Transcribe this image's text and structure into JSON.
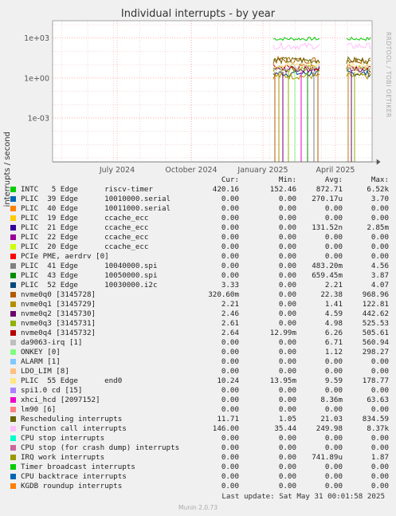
{
  "title": "Individual interrupts - by year",
  "side_label": "RRDTOOL / TOBI OETIKER",
  "footer": {
    "last_update": "Last update: Sat May 31 00:01:58 2025",
    "version": "Munin 2.0.73"
  },
  "legend_headers": {
    "cur": "Cur:",
    "min": "Min:",
    "avg": "Avg:",
    "max": "Max:"
  },
  "chart_data": {
    "type": "line",
    "title": "Individual interrupts - by year",
    "ylabel": "interrupts / second",
    "y_scale": "log",
    "y_ticks": [
      "1e+03",
      "1e+00",
      "1e-03"
    ],
    "y_tick_values": [
      1000,
      1,
      0.001
    ],
    "ylim": [
      5e-07,
      20000
    ],
    "x_ticks": [
      "July 2024",
      "October 2024",
      "January 2025",
      "April 2025"
    ],
    "grid": true,
    "series": [
      {
        "name": "INTC   5 Edge      riscv-timer",
        "color": "#00cc00",
        "cur": "420.16",
        "min": "152.46",
        "avg": "872.71",
        "max": "6.52k"
      },
      {
        "name": "PLIC  39 Edge      10010000.serial",
        "color": "#0066b3",
        "cur": "0.00",
        "min": "0.00",
        "avg": "270.17u",
        "max": "3.70"
      },
      {
        "name": "PLIC  40 Edge      10011000.serial",
        "color": "#ff8000",
        "cur": "0.00",
        "min": "0.00",
        "avg": "0.00",
        "max": "0.00"
      },
      {
        "name": "PLIC  19 Edge      ccache_ecc",
        "color": "#ffcc00",
        "cur": "0.00",
        "min": "0.00",
        "avg": "0.00",
        "max": "0.00"
      },
      {
        "name": "PLIC  21 Edge      ccache_ecc",
        "color": "#330099",
        "cur": "0.00",
        "min": "0.00",
        "avg": "131.52n",
        "max": "2.85m"
      },
      {
        "name": "PLIC  22 Edge      ccache_ecc",
        "color": "#990099",
        "cur": "0.00",
        "min": "0.00",
        "avg": "0.00",
        "max": "0.00"
      },
      {
        "name": "PLIC  20 Edge      ccache_ecc",
        "color": "#ccff00",
        "cur": "0.00",
        "min": "0.00",
        "avg": "0.00",
        "max": "0.00"
      },
      {
        "name": "PCIe PME, aerdrv [0]",
        "color": "#ff0000",
        "cur": "0.00",
        "min": "0.00",
        "avg": "0.00",
        "max": "0.00"
      },
      {
        "name": "PLIC  41 Edge      10040000.spi",
        "color": "#808080",
        "cur": "0.00",
        "min": "0.00",
        "avg": "483.20m",
        "max": "4.56"
      },
      {
        "name": "PLIC  43 Edge      10050000.spi",
        "color": "#008f00",
        "cur": "0.00",
        "min": "0.00",
        "avg": "659.45m",
        "max": "3.87"
      },
      {
        "name": "PLIC  52 Edge      10030000.i2c",
        "color": "#00487d",
        "cur": "3.33",
        "min": "0.00",
        "avg": "2.21",
        "max": "4.07"
      },
      {
        "name": "nvme0q0 [3145728]",
        "color": "#b35a00",
        "cur": "320.60m",
        "min": "0.00",
        "avg": "22.38",
        "max": "968.96"
      },
      {
        "name": "nvme0q1 [3145729]",
        "color": "#b38f00",
        "cur": "2.21",
        "min": "0.00",
        "avg": "1.41",
        "max": "122.81"
      },
      {
        "name": "nvme0q2 [3145730]",
        "color": "#6b006b",
        "cur": "2.46",
        "min": "0.00",
        "avg": "4.59",
        "max": "442.62"
      },
      {
        "name": "nvme0q3 [3145731]",
        "color": "#8fb300",
        "cur": "2.61",
        "min": "0.00",
        "avg": "4.98",
        "max": "525.53"
      },
      {
        "name": "nvme0q4 [3145732]",
        "color": "#b30000",
        "cur": "2.64",
        "min": "12.99m",
        "avg": "6.26",
        "max": "505.61"
      },
      {
        "name": "da9063-irq [1]",
        "color": "#bebebe",
        "cur": "0.00",
        "min": "0.00",
        "avg": "6.71",
        "max": "560.94"
      },
      {
        "name": "ONKEY [0]",
        "color": "#80ff80",
        "cur": "0.00",
        "min": "0.00",
        "avg": "1.12",
        "max": "298.27"
      },
      {
        "name": "ALARM [1]",
        "color": "#80c9ff",
        "cur": "0.00",
        "min": "0.00",
        "avg": "0.00",
        "max": "0.00"
      },
      {
        "name": "LDO_LIM [8]",
        "color": "#ffc080",
        "cur": "0.00",
        "min": "0.00",
        "avg": "0.00",
        "max": "0.00"
      },
      {
        "name": "PLIC  55 Edge      end0",
        "color": "#ffe680",
        "cur": "10.24",
        "min": "13.95m",
        "avg": "9.59",
        "max": "178.77"
      },
      {
        "name": "spi1.0 cd [15]",
        "color": "#aa80ff",
        "cur": "0.00",
        "min": "0.00",
        "avg": "0.00",
        "max": "0.00"
      },
      {
        "name": "xhci_hcd [2097152]",
        "color": "#ee00cc",
        "cur": "0.00",
        "min": "0.00",
        "avg": "8.36m",
        "max": "63.63"
      },
      {
        "name": "lm90 [6]",
        "color": "#ff8080",
        "cur": "0.00",
        "min": "0.00",
        "avg": "0.00",
        "max": "0.00"
      },
      {
        "name": "Rescheduling interrupts",
        "color": "#666600",
        "cur": "11.71",
        "min": "1.05",
        "avg": "21.03",
        "max": "834.59"
      },
      {
        "name": "Function call interrupts",
        "color": "#ffbfff",
        "cur": "146.00",
        "min": "35.44",
        "avg": "249.98",
        "max": "8.37k"
      },
      {
        "name": "CPU stop interrupts",
        "color": "#00ffcc",
        "cur": "0.00",
        "min": "0.00",
        "avg": "0.00",
        "max": "0.00"
      },
      {
        "name": "CPU stop (for crash dump) interrupts",
        "color": "#cc6699",
        "cur": "0.00",
        "min": "0.00",
        "avg": "0.00",
        "max": "0.00"
      },
      {
        "name": "IRQ work interrupts",
        "color": "#999900",
        "cur": "0.00",
        "min": "0.00",
        "avg": "741.89u",
        "max": "1.87"
      },
      {
        "name": "Timer broadcast interrupts",
        "color": "#00cc00",
        "cur": "0.00",
        "min": "0.00",
        "avg": "0.00",
        "max": "0.00"
      },
      {
        "name": "CPU backtrace interrupts",
        "color": "#0066b3",
        "cur": "0.00",
        "min": "0.00",
        "avg": "0.00",
        "max": "0.00"
      },
      {
        "name": "KGDB roundup interrupts",
        "color": "#ff8000",
        "cur": "0.00",
        "min": "0.00",
        "avg": "0.00",
        "max": "0.00"
      }
    ]
  }
}
